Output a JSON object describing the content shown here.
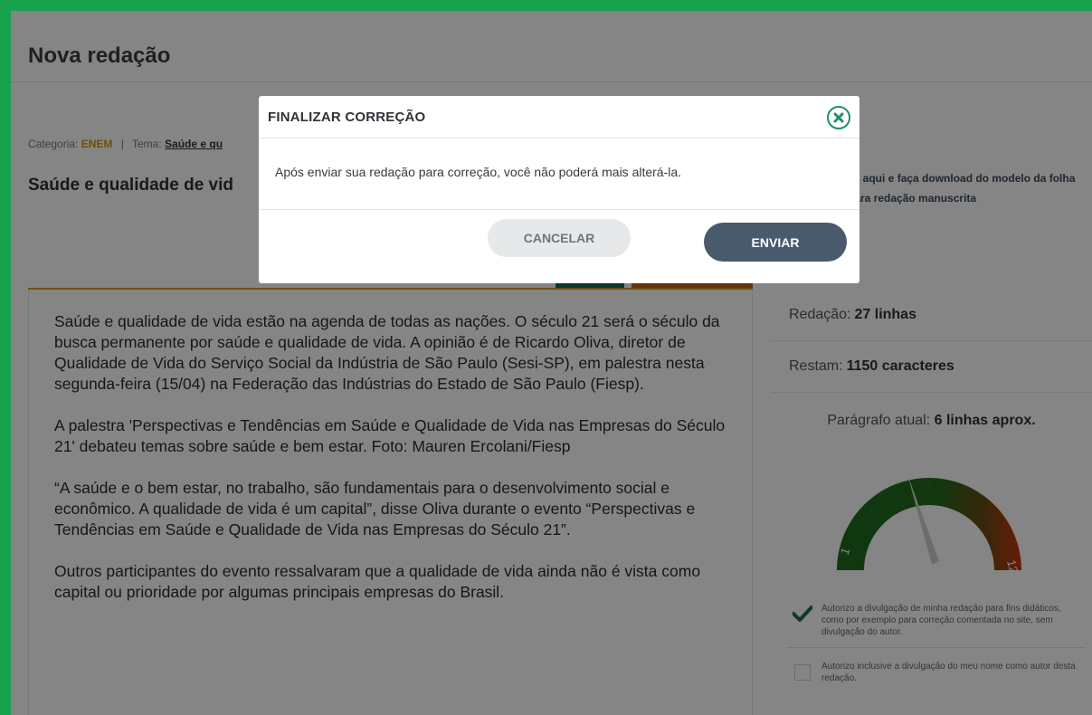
{
  "page": {
    "title": "Nova redação",
    "meta": {
      "category_label": "Categoria:",
      "category_value": "ENEM",
      "separator": "|",
      "theme_label": "Tema:",
      "theme_value": "Saúde e qu"
    },
    "theme_heading": "Saúde e qualidade de vid",
    "download_link": "ck aqui e faça download do modelo da folha para redação manuscrita"
  },
  "essay": {
    "paragraphs": [
      "Saúde e qualidade de vida estão na agenda de todas as nações. O século 21 será o século da busca permanente por saúde e qualidade de vida. A opinião é de Ricardo Oliva, diretor de Qualidade de Vida do Serviço Social da Indústria de São Paulo (Sesi-SP), em palestra nesta segunda-feira (15/04) na Federação das Indústrias do Estado de São Paulo (Fiesp).",
      "A palestra 'Perspectivas e Tendências em Saúde e Qualidade de Vida nas Empresas do Século 21' debateu temas sobre saúde e bem estar. Foto: Mauren Ercolani/Fiesp",
      "“A saúde e o bem estar, no trabalho, são fundamentais para o desenvolvimento social e econômico. A qualidade de vida é um capital”, disse Oliva durante o evento “Perspectivas e Tendências em Saúde e Qualidade de Vida nas Empresas do Século 21”.",
      "Outros participantes do evento ressalvaram que a qualidade de vida ainda não é vista como capital ou prioridade por algumas principais empresas do Brasil."
    ]
  },
  "stats": {
    "lines_label": "Redação:",
    "lines_value": "27 linhas",
    "chars_label": "Restam:",
    "chars_value": "1150 caracteres",
    "para_label": "Parágrafo atual:",
    "para_value": "6 linhas aprox."
  },
  "gauge": {
    "min_label": "1",
    "max_label": "12+",
    "needle_lines": 6,
    "colors": {
      "low": "#1f6b1f",
      "high": "#c6380f"
    }
  },
  "consent": {
    "item1": {
      "checked": true,
      "text": "Autorizo a divulgação de minha redação para fins didáticos, como por exemplo para correção comentada no site, sem divulgação do autor."
    },
    "item2": {
      "checked": false,
      "text": "Autorizo inclusive a divulgação do meu nome como autor desta redação."
    }
  },
  "modal": {
    "title": "FINALIZAR CORREÇÃO",
    "message": "Após enviar sua redação para correção, você não poderá mais alterá-la.",
    "cancel_label": "CANCELAR",
    "send_label": "ENVIAR",
    "close_icon": "close-circle-icon"
  },
  "colors": {
    "frame": "#19a24e",
    "accent": "#d79a12",
    "button_primary": "#4a5a6d"
  }
}
